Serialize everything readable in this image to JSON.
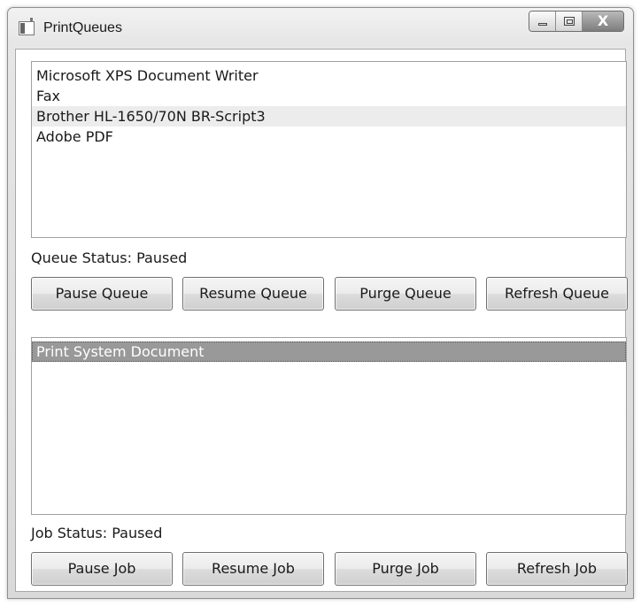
{
  "window": {
    "title": "PrintQueues",
    "close_glyph": "X",
    "icons": {
      "app": "window-app-icon",
      "minimize": "minimize-icon",
      "maximize": "maximize-icon",
      "close": "close-icon"
    }
  },
  "printers": {
    "items": [
      {
        "label": "Microsoft XPS Document Writer",
        "state": "normal"
      },
      {
        "label": "Fax",
        "state": "normal"
      },
      {
        "label": "Brother HL-1650/70N BR-Script3",
        "state": "hover"
      },
      {
        "label": "Adobe PDF",
        "state": "normal"
      }
    ]
  },
  "queue": {
    "status": "Queue Status: Paused",
    "buttons": {
      "pause": "Pause Queue",
      "resume": "Resume Queue",
      "purge": "Purge Queue",
      "refresh": "Refresh Queue"
    }
  },
  "jobs": {
    "items": [
      {
        "label": "Print System Document",
        "state": "selected"
      }
    ]
  },
  "job": {
    "status": "Job Status: Paused",
    "buttons": {
      "pause": "Pause Job",
      "resume": "Resume Job",
      "purge": "Purge Job",
      "refresh": "Refresh Job"
    }
  },
  "colors": {
    "selection": "#999999",
    "hover": "#ececec",
    "border": "#a0a0a0"
  }
}
